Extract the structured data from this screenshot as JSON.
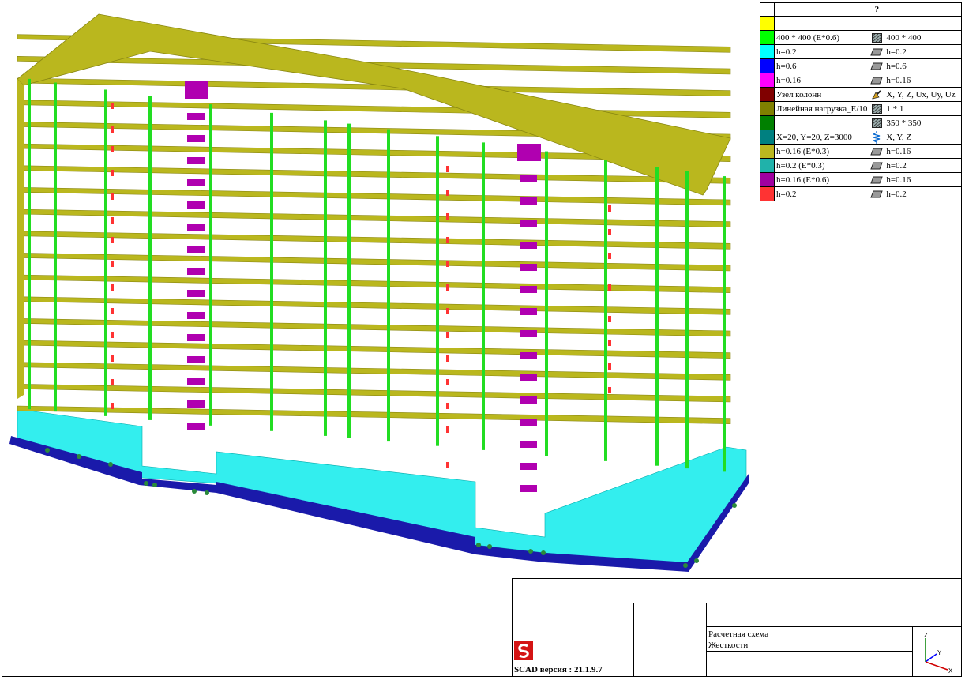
{
  "legend": {
    "header_icon": "?",
    "rows": [
      {
        "color": "#ffff00",
        "label": "",
        "icon": "none",
        "label2": ""
      },
      {
        "color": "#00ff00",
        "label": "400 * 400 (E*0.6)",
        "icon": "hatched-square-icon",
        "label2": "400 * 400"
      },
      {
        "color": "#00ffff",
        "label": "h=0.2",
        "icon": "plate-icon",
        "label2": "h=0.2"
      },
      {
        "color": "#0000ff",
        "label": "h=0.6",
        "icon": "plate-icon",
        "label2": "h=0.6"
      },
      {
        "color": "#ff00ff",
        "label": "h=0.16",
        "icon": "plate-icon",
        "label2": "h=0.16"
      },
      {
        "color": "#800000",
        "label": "Узел колонн",
        "icon": "node-icon",
        "label2": "X, Y, Z, Ux, Uy, Uz"
      },
      {
        "color": "#808000",
        "label": "Линейная нагрузка_E/10",
        "icon": "hatched-square-icon",
        "label2": "1 * 1"
      },
      {
        "color": "#008000",
        "label": "",
        "icon": "hatched-square-icon",
        "label2": "350 * 350"
      },
      {
        "color": "#008080",
        "label": "X=20, Y=20, Z=3000",
        "icon": "spring-icon",
        "label2": "X, Y, Z"
      },
      {
        "color": "#bab71e",
        "label": "h=0.16 (E*0.3)",
        "icon": "plate-icon",
        "label2": "h=0.16"
      },
      {
        "color": "#20b2aa",
        "label": "h=0.2 (E*0.3)",
        "icon": "plate-icon",
        "label2": "h=0.2"
      },
      {
        "color": "#a000a0",
        "label": "h=0.16 (E*0.6)",
        "icon": "plate-icon",
        "label2": "h=0.16"
      },
      {
        "color": "#ff3333",
        "label": "h=0.2",
        "icon": "plate-icon",
        "label2": "h=0.2"
      }
    ]
  },
  "title_block": {
    "line1": "Расчетная схема",
    "line2": "Жесткости",
    "version": "SCAD версия : 21.1.9.7",
    "axis_x": "X",
    "axis_y": "Y",
    "axis_z": "Z"
  },
  "colors": {
    "slab": "#bab71e",
    "column": "#22dd22",
    "core": "#b000b0",
    "foundation": "#33eeee",
    "foundation_edge": "#1a1aaa",
    "opening": "#ff3333"
  }
}
